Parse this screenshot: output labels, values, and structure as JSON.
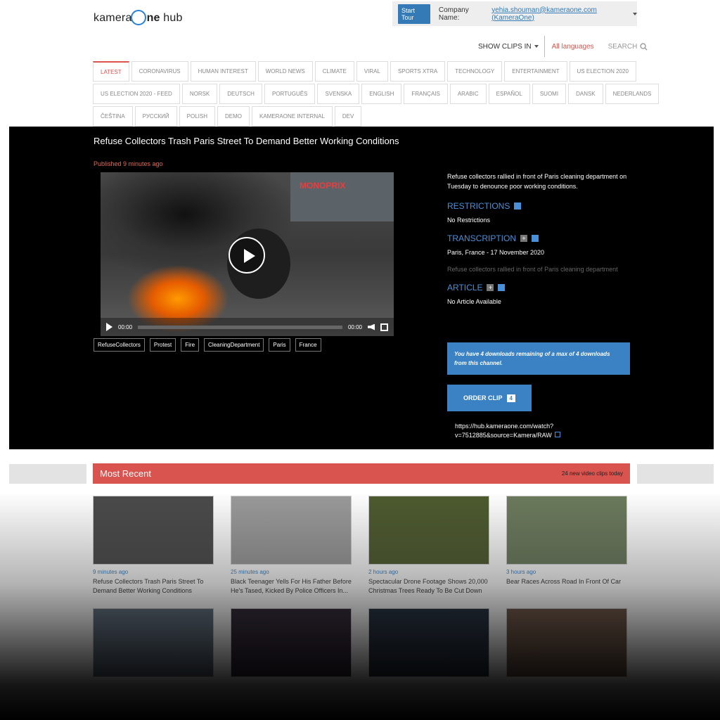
{
  "header": {
    "logo_prefix": "kamera",
    "logo_mid": "ne",
    "logo_suffix": " hub",
    "start_tour": "Start Tour",
    "company_label": "Company Name:",
    "company_value": "yehia.shouman@kameraone.com (KameraOne)"
  },
  "langbar": {
    "show_clips": "SHOW CLIPS IN",
    "all_languages": "All languages",
    "search": "SEARCH"
  },
  "tabs": {
    "row1": [
      "LATEST",
      "CORONAVIRUS",
      "HUMAN INTEREST",
      "WORLD NEWS",
      "CLIMATE",
      "VIRAL",
      "SPORTS XTRA",
      "TECHNOLOGY",
      "ENTERTAINMENT",
      "US ELECTION 2020"
    ],
    "row2": [
      "US ELECTION 2020 - FEED",
      "NORSK",
      "DEUTSCH",
      "PORTUGUÊS",
      "SVENSKA",
      "ENGLISH",
      "FRANÇAIS",
      "ARABIC",
      "ESPAÑOL",
      "SUOMI",
      "DANSK",
      "NEDERLANDS"
    ],
    "row3": [
      "ČEŠTINA",
      "РУССКИЙ",
      "POLISH",
      "DEMO",
      "KAMERAONE INTERNAL",
      "DEV"
    ]
  },
  "hero": {
    "title": "Refuse Collectors Trash Paris Street To Demand Better Working Conditions",
    "published": "Published 9 minutes ago",
    "video_sign": "MONOPRIX",
    "time_current": "00:00",
    "time_total": "00:00",
    "tags": [
      "RefuseCollectors",
      "Protest",
      "Fire",
      "CleaningDepartment",
      "Paris",
      "France"
    ],
    "description": "Refuse collectors rallied in front of Paris cleaning department on Tuesday to denounce poor working conditions.",
    "restrictions_h": "RESTRICTIONS",
    "restrictions_v": "No Restrictions",
    "transcription_h": "TRANSCRIPTION",
    "transcription_v": "Paris, France - 17 November 2020",
    "transcription_fade": "Refuse collectors rallied in front of Paris cleaning department",
    "article_h": "ARTICLE",
    "article_v": "No Article Available",
    "notice": "You have 4 downloads remaining of a max of 4 downloads from this channel.",
    "order_label": "ORDER CLIP",
    "order_count": "4",
    "url": "https://hub.kameraone.com/watch?v=7512885&source=Kamera/RAW"
  },
  "most_recent": {
    "title": "Most Recent",
    "count": "24 new video clips today",
    "cards": [
      {
        "time": "9 minutes ago",
        "title": "Refuse Collectors Trash Paris Street To Demand Better Working Conditions",
        "color": "#4a4a4a"
      },
      {
        "time": "25 minutes ago",
        "title": "Black Teenager Yells For His Father Before He's Tased, Kicked By Police Officers In...",
        "color": "#9a9a9a"
      },
      {
        "time": "2 hours ago",
        "title": "Spectacular Drone Footage Shows 20,000 Christmas Trees Ready To Be Cut Down",
        "color": "#4d5a2e"
      },
      {
        "time": "3 hours ago",
        "title": "Bear Races Across Road In Front Of Car",
        "color": "#6b7a5c"
      },
      {
        "time": "",
        "title": "",
        "color": "#5a6a7a"
      },
      {
        "time": "",
        "title": "",
        "color": "#2a2030"
      },
      {
        "time": "",
        "title": "",
        "color": "#1c2838"
      },
      {
        "time": "",
        "title": "",
        "color": "#6a5040"
      }
    ]
  }
}
